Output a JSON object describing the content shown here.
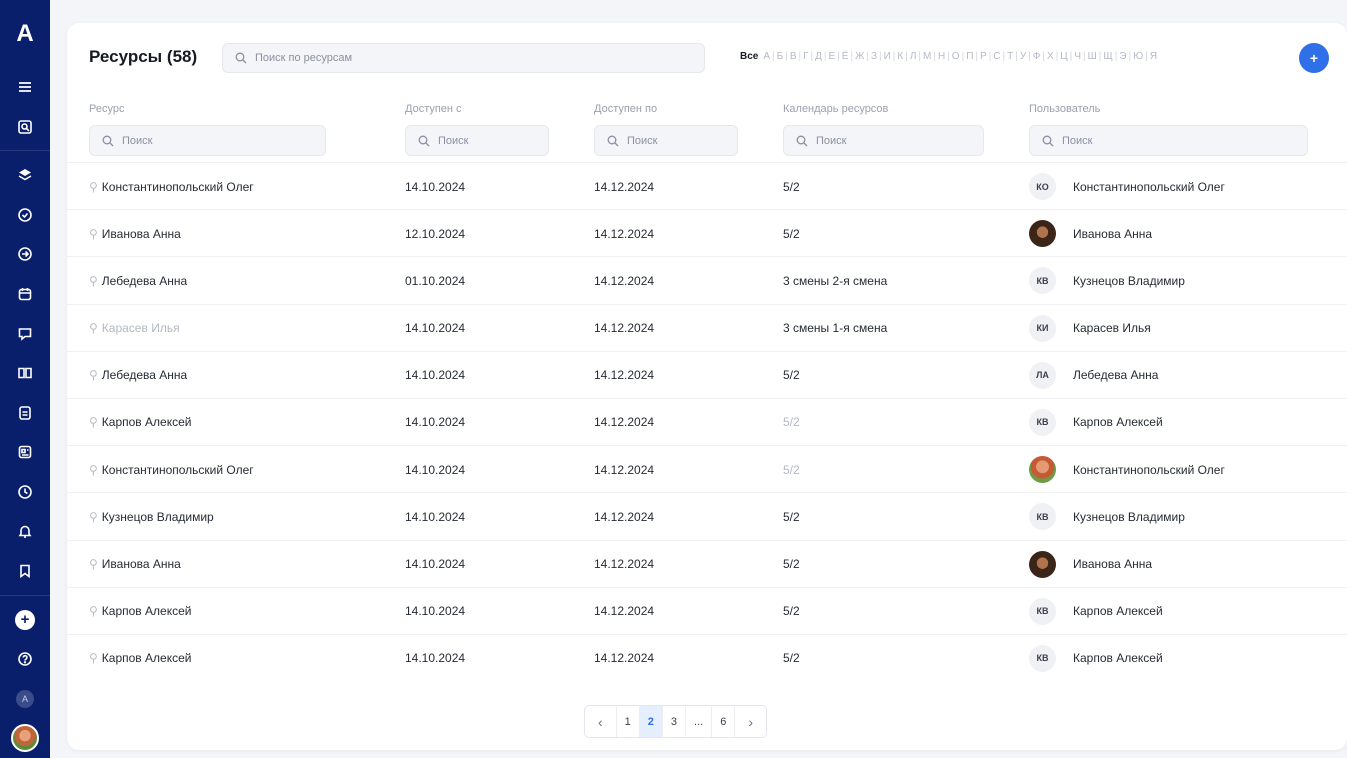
{
  "sidebar": {
    "logo": "A",
    "items": [
      {
        "name": "menu-icon"
      },
      {
        "name": "search-doc-icon"
      },
      {
        "name": "layers-icon"
      },
      {
        "name": "check-circle-icon"
      },
      {
        "name": "arrow-circle-icon"
      },
      {
        "name": "calendar-icon"
      },
      {
        "name": "chat-icon"
      },
      {
        "name": "book-icon"
      },
      {
        "name": "document-icon"
      },
      {
        "name": "newspaper-icon"
      },
      {
        "name": "clock-icon"
      },
      {
        "name": "bell-icon"
      },
      {
        "name": "bookmark-icon"
      }
    ],
    "add_label": "+",
    "help_icon": "help-icon",
    "mini_badge": "A"
  },
  "header": {
    "title": "Ресурсы (58)",
    "search_placeholder": "Поиск по ресурсам",
    "alphabet_all": "Все",
    "alphabet": [
      "А",
      "Б",
      "В",
      "Г",
      "Д",
      "Е",
      "Ё",
      "Ж",
      "З",
      "И",
      "К",
      "Л",
      "М",
      "Н",
      "О",
      "П",
      "Р",
      "С",
      "Т",
      "У",
      "Ф",
      "Х",
      "Ц",
      "Ч",
      "Ш",
      "Щ",
      "Э",
      "Ю",
      "Я"
    ],
    "add_label": "+"
  },
  "columns": {
    "resource": {
      "label": "Ресурс",
      "placeholder": "Поиск"
    },
    "from": {
      "label": "Доступен с",
      "placeholder": "Поиск"
    },
    "to": {
      "label": "Доступен по",
      "placeholder": "Поиск"
    },
    "calendar": {
      "label": "Календарь ресурсов",
      "placeholder": "Поиск"
    },
    "user": {
      "label": "Пользователь",
      "placeholder": "Поиск"
    }
  },
  "rows": [
    {
      "resource": "Константинопольский Олег",
      "from": "14.10.2024",
      "to": "14.12.2024",
      "calendar": "5/2",
      "avatar": "КО",
      "user": "Константинопольский Олег"
    },
    {
      "resource": "Иванова Анна",
      "from": "12.10.2024",
      "to": "14.12.2024",
      "calendar": "5/2",
      "avatar": "",
      "avatar_type": "photo-f",
      "user": "Иванова Анна"
    },
    {
      "resource": "Лебедева Анна",
      "from": "01.10.2024",
      "to": "14.12.2024",
      "calendar": "3 смены 2-я смена",
      "avatar": "КВ",
      "user": "Кузнецов Владимир"
    },
    {
      "resource": "Карасев Илья",
      "resource_dim": true,
      "from": "14.10.2024",
      "to": "14.12.2024",
      "calendar": "3 смены 1-я смена",
      "avatar": "КИ",
      "user": "Карасев Илья"
    },
    {
      "resource": "Лебедева Анна",
      "from": "14.10.2024",
      "to": "14.12.2024",
      "calendar": "5/2",
      "avatar": "ЛА",
      "user": "Лебедева Анна"
    },
    {
      "resource": "Карпов Алексей",
      "from": "14.10.2024",
      "to": "14.12.2024",
      "calendar": "5/2",
      "calendar_dim": true,
      "avatar": "КВ",
      "user": "Карпов Алексей"
    },
    {
      "resource": "Константинопольский Олег",
      "from": "14.10.2024",
      "to": "14.12.2024",
      "calendar": "5/2",
      "calendar_dim": true,
      "avatar": "",
      "avatar_type": "photo-m",
      "user": "Константинопольский Олег"
    },
    {
      "resource": "Кузнецов Владимир",
      "from": "14.10.2024",
      "to": "14.12.2024",
      "calendar": "5/2",
      "avatar": "КВ",
      "user": "Кузнецов Владимир"
    },
    {
      "resource": "Иванова Анна",
      "from": "14.10.2024",
      "to": "14.12.2024",
      "calendar": "5/2",
      "avatar": "",
      "avatar_type": "photo-f",
      "user": "Иванова Анна"
    },
    {
      "resource": "Карпов Алексей",
      "from": "14.10.2024",
      "to": "14.12.2024",
      "calendar": "5/2",
      "avatar": "КВ",
      "user": "Карпов Алексей"
    },
    {
      "resource": "Карпов Алексей",
      "from": "14.10.2024",
      "to": "14.12.2024",
      "calendar": "5/2",
      "avatar": "КВ",
      "user": "Карпов Алексей"
    }
  ],
  "pagination": {
    "prev": "‹",
    "pages": [
      "1",
      "2",
      "3",
      "...",
      "6"
    ],
    "active": "2",
    "next": "›"
  },
  "colors": {
    "sidebar": "#0a1f6b",
    "accent": "#2f6fe8"
  }
}
